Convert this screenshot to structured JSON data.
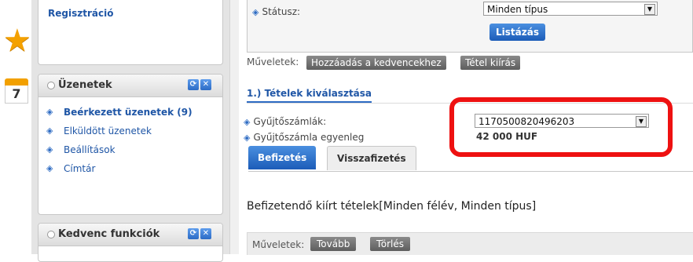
{
  "colors": {
    "accent": "#2d6bc3",
    "link": "#1f56a6",
    "highlight": "#ee1111",
    "star": "#f4a100"
  },
  "icons": {
    "star": "star-icon",
    "calendar": "calendar-icon",
    "bullet": "blue-diamond-icon",
    "refresh": "refresh-icon",
    "close": "close-icon"
  },
  "sidebar": {
    "register_link": "Regisztráció",
    "calendar_day": "7",
    "messages": {
      "title": "Üzenetek",
      "items": [
        {
          "label": "Beérkezett üzenetek (9)"
        },
        {
          "label": "Elküldött üzenetek"
        },
        {
          "label": "Beállítások"
        },
        {
          "label": "Címtár"
        }
      ]
    },
    "favorites": {
      "title": "Kedvenc funkciók"
    }
  },
  "filter": {
    "status_label": "Státusz:",
    "status_value": "Minden típus",
    "list_button": "Listázás"
  },
  "operations": {
    "label": "Műveletek:",
    "add_favorite": "Hozzáadás a kedvencekhez",
    "export": "Tétel kiírás"
  },
  "section": {
    "title": "1.) Tételek kiválasztása",
    "collector_label": "Gyűjtőszámlák:",
    "collector_value": "1170500820496203",
    "balance_label": "Gyűjtőszámla egyenleg",
    "balance_value": "42 000 HUF"
  },
  "tabs": [
    {
      "label": "Befizetés",
      "active": true
    },
    {
      "label": "Visszafizetés",
      "active": false
    }
  ],
  "payable": {
    "title": "Befizetendő kiírt tételek[Minden félév, Minden típus]",
    "ops_label": "Műveletek:",
    "next": "Tovább",
    "delete": "Törlés"
  }
}
